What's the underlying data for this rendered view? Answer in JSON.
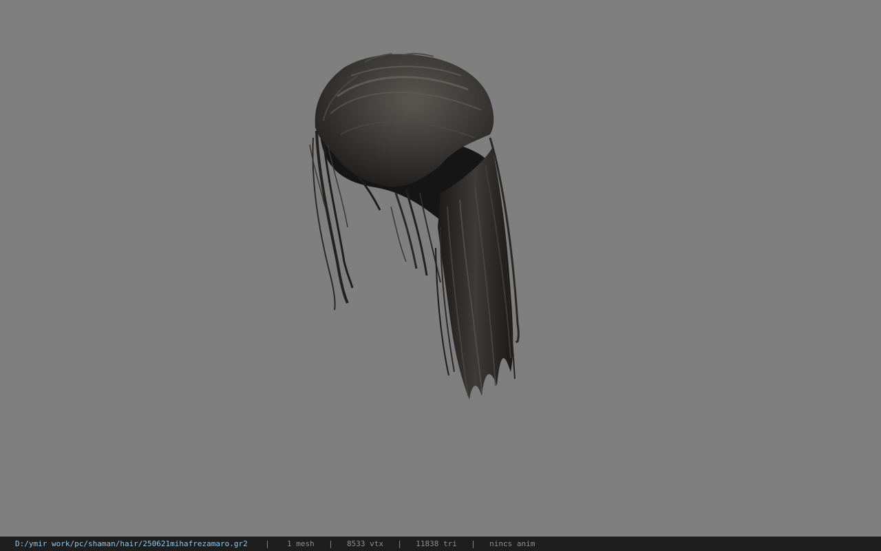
{
  "viewport": {
    "background_color": "#7f7f7f",
    "model_kind": "hair mesh (ponytail)"
  },
  "statusbar": {
    "file_path": "D:/ymir work/pc/shaman/hair/250621mihafrezamaro.gr2",
    "separator": "|",
    "mesh_count": "1 mesh",
    "vertex_count": "8533 vtx",
    "triangle_count": "11838 tri",
    "anim_status": "nincs anim",
    "path_color": "#8fc8e8",
    "text_color": "#8f8f8f",
    "background_color": "#1e1e1e"
  }
}
